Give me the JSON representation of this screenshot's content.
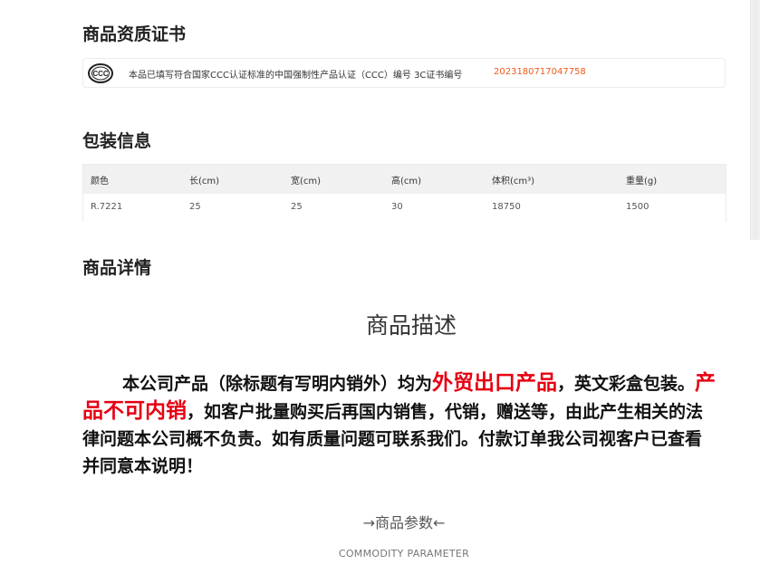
{
  "certificate": {
    "title": "商品资质证书",
    "icon": "ccc-logo-icon",
    "text": "本品已填写符合国家CCC认证标准的中国强制性产品认证（CCC）编号 3C证书编号",
    "number": "2023180717047758",
    "number_color": "#f05a1a"
  },
  "packaging": {
    "title": "包装信息",
    "headers": [
      "颜色",
      "长(cm)",
      "宽(cm)",
      "高(cm)",
      "体积(cm³)",
      "重量(g)"
    ],
    "rows": [
      [
        "R.7221",
        "25",
        "25",
        "30",
        "18750",
        "1500"
      ]
    ]
  },
  "details": {
    "title": "商品详情",
    "description_heading": "商品描述",
    "description": {
      "p1": "本公司产品（除标题有写明内销外）均为",
      "hl1": "外贸出口产品",
      "p2": "，英文彩盒包装。",
      "hl2": "产品不可内销",
      "p3": "，如客户批量购买后再国内销售，代销，赠送等，由此产生相关的法律问题本公司概不负责。如有质量问题可联系我们。付款订单我公司视客户已查看并同意本说明！",
      "highlight_color": "#e60012"
    },
    "param_heading": "→商品参数←",
    "param_subheading": "COMMODITY  PARAMETER"
  }
}
